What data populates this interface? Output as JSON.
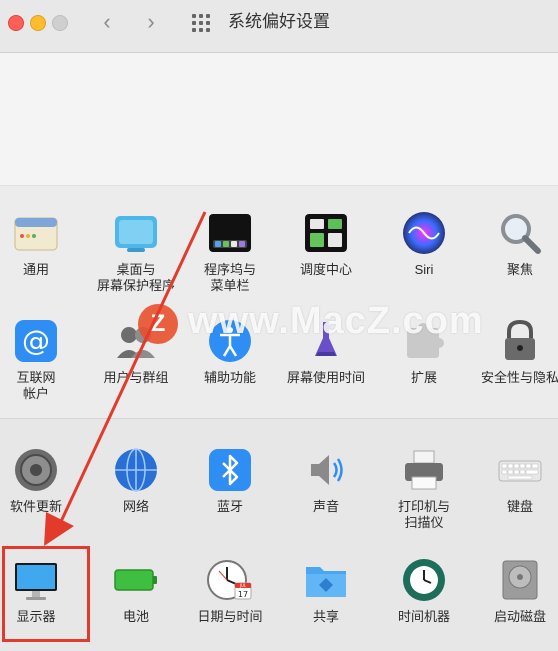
{
  "window": {
    "title": "系统偏好设置",
    "nav_back": "‹",
    "nav_forward": "›"
  },
  "row1": [
    {
      "label": "通用",
      "icon": "general-icon"
    },
    {
      "label": "桌面与\n屏幕保护程序",
      "icon": "desktop-screensaver-icon"
    },
    {
      "label": "程序坞与\n菜单栏",
      "icon": "dock-menubar-icon"
    },
    {
      "label": "调度中心",
      "icon": "mission-control-icon"
    },
    {
      "label": "Siri",
      "icon": "siri-icon"
    },
    {
      "label": "聚焦",
      "icon": "spotlight-icon"
    }
  ],
  "row2": [
    {
      "label": "互联网\n帐户",
      "icon": "internet-accounts-icon"
    },
    {
      "label": "用户与群组",
      "icon": "users-groups-icon"
    },
    {
      "label": "辅助功能",
      "icon": "accessibility-icon"
    },
    {
      "label": "屏幕使用时间",
      "icon": "screen-time-icon"
    },
    {
      "label": "扩展",
      "icon": "extensions-icon"
    },
    {
      "label": "安全性与隐私",
      "icon": "security-privacy-icon"
    }
  ],
  "row3": [
    {
      "label": "软件更新",
      "icon": "software-update-icon"
    },
    {
      "label": "网络",
      "icon": "network-icon"
    },
    {
      "label": "蓝牙",
      "icon": "bluetooth-icon"
    },
    {
      "label": "声音",
      "icon": "sound-icon"
    },
    {
      "label": "打印机与\n扫描仪",
      "icon": "printers-scanners-icon"
    },
    {
      "label": "键盘",
      "icon": "keyboard-icon"
    }
  ],
  "row4": [
    {
      "label": "显示器",
      "icon": "displays-icon"
    },
    {
      "label": "电池",
      "icon": "battery-icon"
    },
    {
      "label": "日期与时间",
      "icon": "date-time-icon"
    },
    {
      "label": "共享",
      "icon": "sharing-icon"
    },
    {
      "label": "时间机器",
      "icon": "time-machine-icon"
    },
    {
      "label": "启动磁盘",
      "icon": "startup-disk-icon"
    }
  ],
  "calendar_day": "17",
  "calendar_month": "JUL",
  "watermark": {
    "logo": "Z",
    "text": "www.MacZ.com"
  },
  "colors": {
    "annotation": "#e23b2c",
    "accent": "#1d8cf0"
  }
}
